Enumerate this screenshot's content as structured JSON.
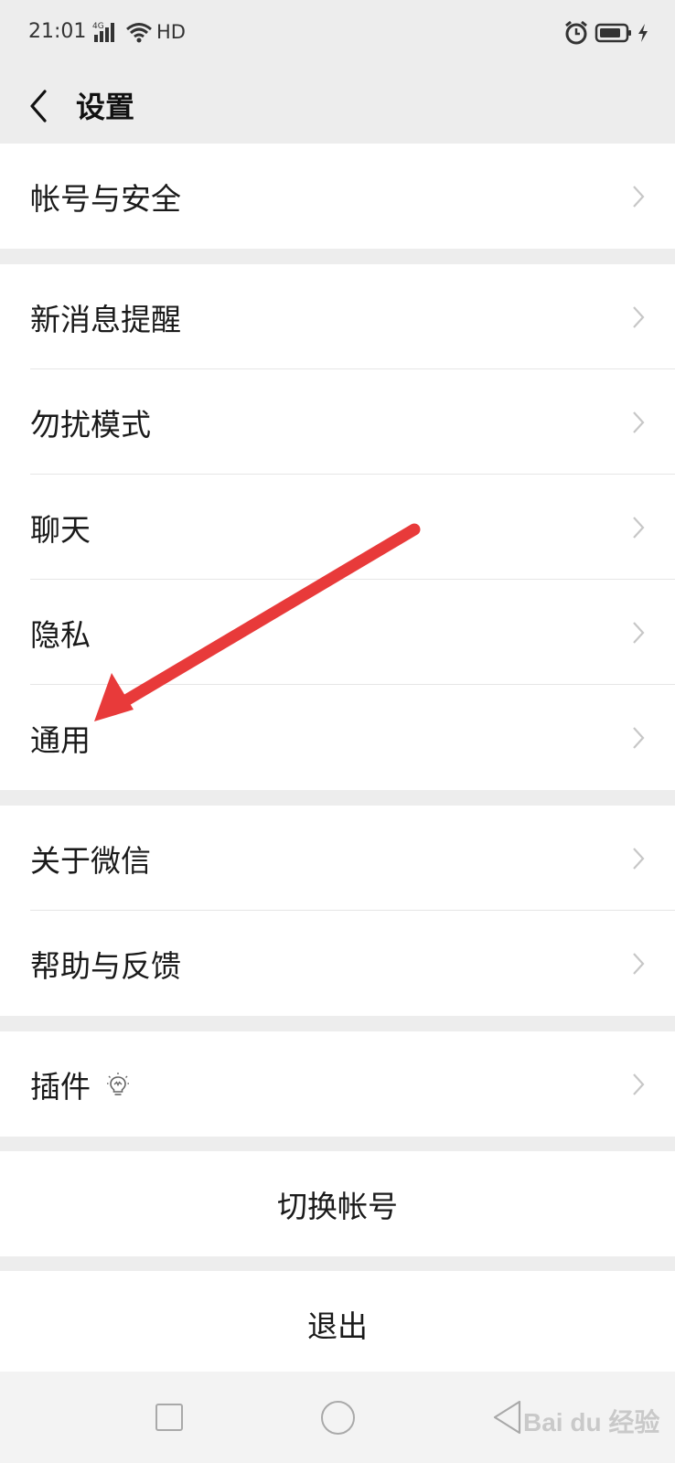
{
  "status_bar": {
    "time": "21:01",
    "network": "4G",
    "hd": "HD",
    "icons": [
      "signal-icon",
      "wifi-icon",
      "alarm-icon",
      "battery-icon",
      "charging-icon"
    ]
  },
  "header": {
    "back_icon": "chevron-left-icon",
    "title": "设置"
  },
  "groups": [
    {
      "items": [
        {
          "label": "帐号与安全"
        }
      ]
    },
    {
      "items": [
        {
          "label": "新消息提醒"
        },
        {
          "label": "勿扰模式"
        },
        {
          "label": "聊天"
        },
        {
          "label": "隐私"
        },
        {
          "label": "通用"
        }
      ]
    },
    {
      "items": [
        {
          "label": "关于微信"
        },
        {
          "label": "帮助与反馈"
        }
      ]
    },
    {
      "items": [
        {
          "label": "插件",
          "icon": "lightbulb-icon"
        }
      ]
    }
  ],
  "actions": {
    "switch_account": "切换帐号",
    "logout": "退出"
  },
  "nav_bar": {
    "icons": [
      "recent-apps-icon",
      "home-icon",
      "back-triangle-icon"
    ]
  },
  "watermark": "Bai du 经验",
  "annotation": {
    "color": "#e83a3a",
    "points_to": "通用"
  },
  "colors": {
    "background": "#ededed",
    "card": "#ffffff",
    "chevron": "#c7c7c7"
  }
}
